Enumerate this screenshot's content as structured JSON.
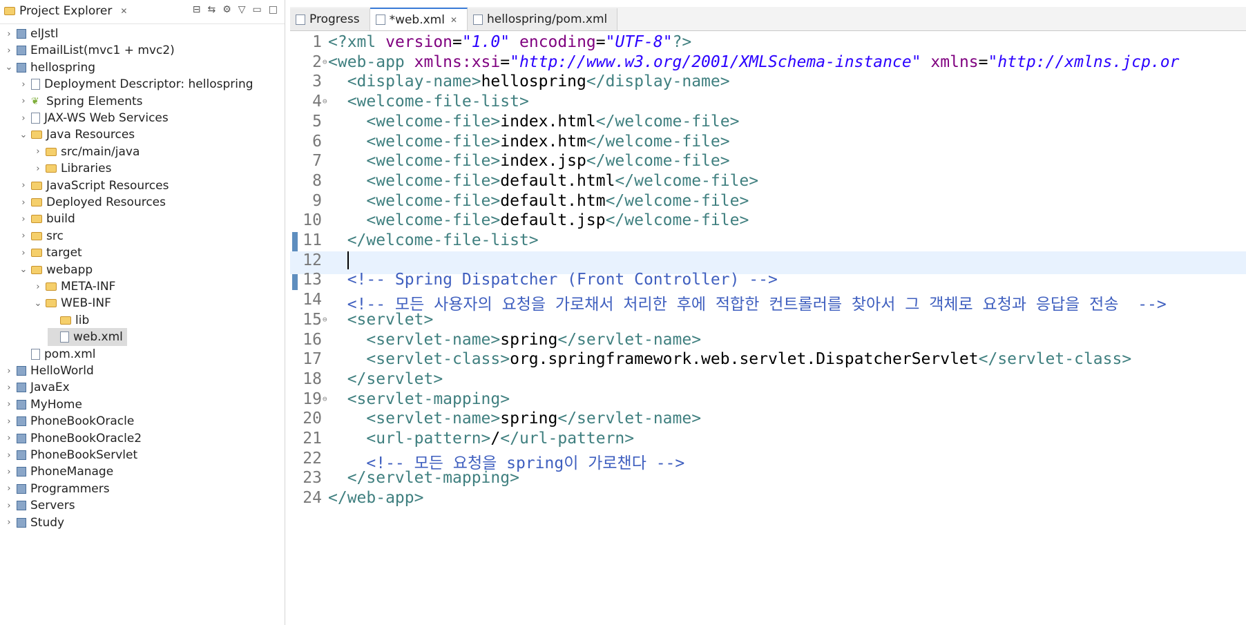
{
  "explorer": {
    "title": "Project Explorer",
    "items": [
      {
        "label": "elJstl",
        "depth": 0,
        "exp": "right",
        "icon": "proj"
      },
      {
        "label": "EmailList(mvc1 + mvc2)",
        "depth": 0,
        "exp": "right",
        "icon": "proj"
      },
      {
        "label": "hellospring",
        "depth": 0,
        "exp": "down",
        "icon": "proj"
      },
      {
        "label": "Deployment Descriptor: hellospring",
        "depth": 1,
        "exp": "right",
        "icon": "file"
      },
      {
        "label": "Spring Elements",
        "depth": 1,
        "exp": "right",
        "icon": "leaf"
      },
      {
        "label": "JAX-WS Web Services",
        "depth": 1,
        "exp": "right",
        "icon": "file"
      },
      {
        "label": "Java Resources",
        "depth": 1,
        "exp": "down",
        "icon": "folder"
      },
      {
        "label": "src/main/java",
        "depth": 2,
        "exp": "right",
        "icon": "folder"
      },
      {
        "label": "Libraries",
        "depth": 2,
        "exp": "right",
        "icon": "folder"
      },
      {
        "label": "JavaScript Resources",
        "depth": 1,
        "exp": "right",
        "icon": "folder"
      },
      {
        "label": "Deployed Resources",
        "depth": 1,
        "exp": "right",
        "icon": "folder"
      },
      {
        "label": "build",
        "depth": 1,
        "exp": "right",
        "icon": "folder"
      },
      {
        "label": "src",
        "depth": 1,
        "exp": "right",
        "icon": "folder"
      },
      {
        "label": "target",
        "depth": 1,
        "exp": "right",
        "icon": "folder"
      },
      {
        "label": "webapp",
        "depth": 1,
        "exp": "down",
        "icon": "folder"
      },
      {
        "label": "META-INF",
        "depth": 2,
        "exp": "right",
        "icon": "folder"
      },
      {
        "label": "WEB-INF",
        "depth": 2,
        "exp": "down",
        "icon": "folder"
      },
      {
        "label": "lib",
        "depth": 3,
        "exp": "none",
        "icon": "folder"
      },
      {
        "label": "web.xml",
        "depth": 3,
        "exp": "none",
        "icon": "file",
        "selected": true
      },
      {
        "label": "pom.xml",
        "depth": 1,
        "exp": "none",
        "icon": "file"
      },
      {
        "label": "HelloWorld",
        "depth": 0,
        "exp": "right",
        "icon": "proj"
      },
      {
        "label": "JavaEx",
        "depth": 0,
        "exp": "right",
        "icon": "proj"
      },
      {
        "label": "MyHome",
        "depth": 0,
        "exp": "right",
        "icon": "proj"
      },
      {
        "label": "PhoneBookOracle",
        "depth": 0,
        "exp": "right",
        "icon": "proj"
      },
      {
        "label": "PhoneBookOracle2",
        "depth": 0,
        "exp": "right",
        "icon": "proj"
      },
      {
        "label": "PhoneBookServlet",
        "depth": 0,
        "exp": "right",
        "icon": "proj"
      },
      {
        "label": "PhoneManage",
        "depth": 0,
        "exp": "right",
        "icon": "proj"
      },
      {
        "label": "Programmers",
        "depth": 0,
        "exp": "right",
        "icon": "proj"
      },
      {
        "label": "Servers",
        "depth": 0,
        "exp": "right",
        "icon": "proj"
      },
      {
        "label": "Study",
        "depth": 0,
        "exp": "right",
        "icon": "proj"
      }
    ]
  },
  "tabs": [
    {
      "label": "Progress",
      "active": false,
      "closable": false
    },
    {
      "label": "*web.xml",
      "active": true,
      "closable": true
    },
    {
      "label": "hellospring/pom.xml",
      "active": false,
      "closable": false
    }
  ],
  "code": [
    {
      "n": "1",
      "t": [
        [
          "tag",
          "<?xml "
        ],
        [
          "attr",
          "version"
        ],
        [
          "txt",
          "="
        ],
        [
          "val",
          "\"1.0\""
        ],
        [
          "txt",
          " "
        ],
        [
          "attr",
          "encoding"
        ],
        [
          "txt",
          "="
        ],
        [
          "val",
          "\"UTF-8\""
        ],
        [
          "tag",
          "?>"
        ]
      ]
    },
    {
      "n": "2",
      "fold": true,
      "t": [
        [
          "tag",
          "<web-app "
        ],
        [
          "attr",
          "xmlns:xsi"
        ],
        [
          "txt",
          "="
        ],
        [
          "val",
          "\"http://www.w3.org/2001/XMLSchema-instance\""
        ],
        [
          "txt",
          " "
        ],
        [
          "attr",
          "xmlns"
        ],
        [
          "txt",
          "="
        ],
        [
          "val",
          "\"http://xmlns.jcp.or"
        ]
      ]
    },
    {
      "n": "3",
      "t": [
        [
          "tag",
          "  <display-name>"
        ],
        [
          "txt",
          "hellospring"
        ],
        [
          "tag",
          "</display-name>"
        ]
      ]
    },
    {
      "n": "4",
      "fold": true,
      "t": [
        [
          "tag",
          "  <welcome-file-list>"
        ]
      ]
    },
    {
      "n": "5",
      "t": [
        [
          "tag",
          "    <welcome-file>"
        ],
        [
          "txt",
          "index.html"
        ],
        [
          "tag",
          "</welcome-file>"
        ]
      ]
    },
    {
      "n": "6",
      "t": [
        [
          "tag",
          "    <welcome-file>"
        ],
        [
          "txt",
          "index.htm"
        ],
        [
          "tag",
          "</welcome-file>"
        ]
      ]
    },
    {
      "n": "7",
      "t": [
        [
          "tag",
          "    <welcome-file>"
        ],
        [
          "txt",
          "index.jsp"
        ],
        [
          "tag",
          "</welcome-file>"
        ]
      ]
    },
    {
      "n": "8",
      "t": [
        [
          "tag",
          "    <welcome-file>"
        ],
        [
          "txt",
          "default.html"
        ],
        [
          "tag",
          "</welcome-file>"
        ]
      ]
    },
    {
      "n": "9",
      "t": [
        [
          "tag",
          "    <welcome-file>"
        ],
        [
          "txt",
          "default.htm"
        ],
        [
          "tag",
          "</welcome-file>"
        ]
      ]
    },
    {
      "n": "10",
      "t": [
        [
          "tag",
          "    <welcome-file>"
        ],
        [
          "txt",
          "default.jsp"
        ],
        [
          "tag",
          "</welcome-file>"
        ]
      ]
    },
    {
      "n": "11",
      "t": [
        [
          "tag",
          "  </welcome-file-list>"
        ]
      ]
    },
    {
      "n": "12",
      "cur": true,
      "t": [
        [
          "txt",
          "  "
        ]
      ]
    },
    {
      "n": "13",
      "t": [
        [
          "cmt",
          "  <!-- Spring Dispatcher (Front Controller) -->"
        ]
      ]
    },
    {
      "n": "14",
      "t": [
        [
          "cmt",
          "  <!-- 모든 사용자의 요청을 가로채서 처리한 후에 적합한 컨트롤러를 찾아서 그 객체로 요청과 응답을 전송  -->"
        ]
      ]
    },
    {
      "n": "15",
      "fold": true,
      "t": [
        [
          "tag",
          "  <servlet>"
        ]
      ]
    },
    {
      "n": "16",
      "t": [
        [
          "tag",
          "    <servlet-name>"
        ],
        [
          "txt",
          "spring"
        ],
        [
          "tag",
          "</servlet-name>"
        ]
      ]
    },
    {
      "n": "17",
      "t": [
        [
          "tag",
          "    <servlet-class>"
        ],
        [
          "txt",
          "org.springframework.web.servlet.DispatcherServlet"
        ],
        [
          "tag",
          "</servlet-class>"
        ]
      ]
    },
    {
      "n": "18",
      "t": [
        [
          "tag",
          "  </servlet>"
        ]
      ]
    },
    {
      "n": "19",
      "fold": true,
      "t": [
        [
          "tag",
          "  <servlet-mapping>"
        ]
      ]
    },
    {
      "n": "20",
      "t": [
        [
          "tag",
          "    <servlet-name>"
        ],
        [
          "txt",
          "spring"
        ],
        [
          "tag",
          "</servlet-name>"
        ]
      ]
    },
    {
      "n": "21",
      "t": [
        [
          "tag",
          "    <url-pattern>"
        ],
        [
          "txt",
          "/"
        ],
        [
          "tag",
          "</url-pattern>"
        ]
      ]
    },
    {
      "n": "22",
      "t": [
        [
          "cmt",
          "    <!-- 모든 요청을 spring이 가로챈다 -->"
        ]
      ]
    },
    {
      "n": "23",
      "t": [
        [
          "tag",
          "  </servlet-mapping>"
        ]
      ]
    },
    {
      "n": "24",
      "t": [
        [
          "tag",
          "</web-app>"
        ]
      ]
    }
  ]
}
